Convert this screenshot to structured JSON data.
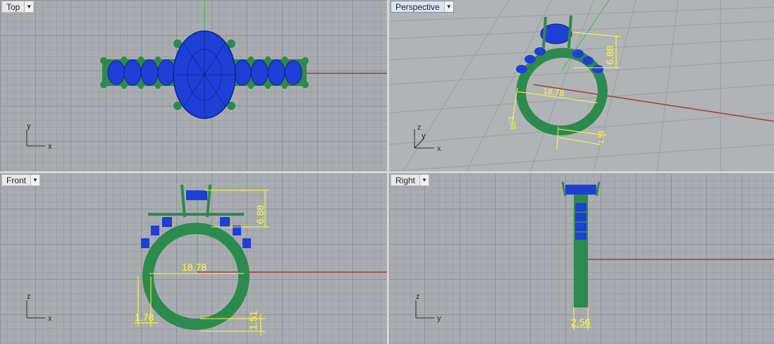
{
  "viewports": {
    "top": {
      "label": "Top",
      "axis_h": "x",
      "axis_v": "y"
    },
    "perspective": {
      "label": "Perspective",
      "axis_h": "x",
      "axis_v": "y",
      "axis_z": "z"
    },
    "front": {
      "label": "Front",
      "axis_h": "x",
      "axis_v": "z"
    },
    "right": {
      "label": "Right",
      "axis_h": "y",
      "axis_v": "z"
    }
  },
  "dimensions": {
    "height": "6.88",
    "inner_diameter": "18.78",
    "shank_thickness": "1.78",
    "bottom_thickness": "1.51",
    "band_width": "2.56"
  },
  "colors": {
    "metal": "#2d8a4e",
    "stone": "#1d3fd6",
    "dimension": "#ffff33",
    "x_axis": "#a33a3a",
    "z_axis": "#3fbf3f",
    "active_tab": "#dce6f2"
  },
  "icons": {
    "dropdown": "chevron-down-icon"
  }
}
